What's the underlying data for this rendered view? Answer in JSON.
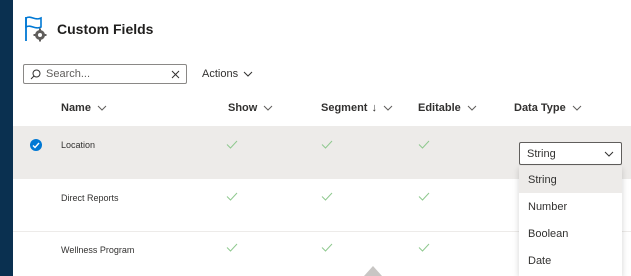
{
  "header": {
    "title": "Custom Fields",
    "logo_icon": "flag-gear-icon"
  },
  "toolbar": {
    "search_placeholder": "Search...",
    "actions_label": "Actions"
  },
  "columns": [
    {
      "label": "Name",
      "sort": "",
      "menu": true
    },
    {
      "label": "Show",
      "sort": "",
      "menu": true
    },
    {
      "label": "Segment",
      "sort": "↓",
      "menu": true
    },
    {
      "label": "Editable",
      "sort": "",
      "menu": true
    },
    {
      "label": "Data Type",
      "sort": "",
      "menu": true
    }
  ],
  "rows": [
    {
      "name": "Location",
      "show": true,
      "segment": true,
      "editable": true,
      "selected": true
    },
    {
      "name": "Direct Reports",
      "show": true,
      "segment": true,
      "editable": true,
      "selected": false
    },
    {
      "name": "Wellness Program",
      "show": true,
      "segment": true,
      "editable": true,
      "selected": false
    }
  ],
  "data_type_dropdown": {
    "value": "String",
    "options": [
      "String",
      "Number",
      "Boolean",
      "Date"
    ],
    "highlighted": "String"
  },
  "colors": {
    "background": "#0a3050",
    "accent": "#0078d4",
    "check": "#8fc98f",
    "selected_row": "#edebe9"
  }
}
